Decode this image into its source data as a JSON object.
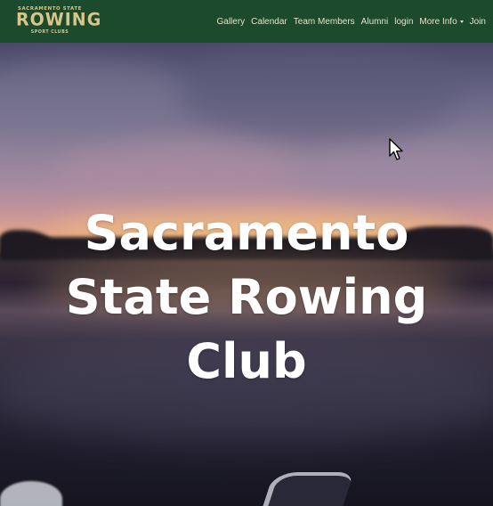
{
  "logo": {
    "top_text": "SACRAMENTO STATE",
    "main_text": "ROWING",
    "bottom_text": "SPORT CLUBS"
  },
  "nav": {
    "items": [
      {
        "label": "Gallery"
      },
      {
        "label": "Calendar"
      },
      {
        "label": "Team Members"
      },
      {
        "label": "Alumni"
      },
      {
        "label": "login"
      },
      {
        "label": "More Info"
      },
      {
        "label": "Join"
      }
    ]
  },
  "hero": {
    "title": "Sacramento State Rowing Club"
  },
  "colors": {
    "navbar_bg": "#1b4a2c",
    "logo_gold": "#d8c58a",
    "nav_text": "#e6e2cc",
    "hero_title": "#ffffff"
  },
  "icons": {
    "more_info_caret": "caret-down-icon",
    "pointer": "mouse-cursor-icon"
  }
}
